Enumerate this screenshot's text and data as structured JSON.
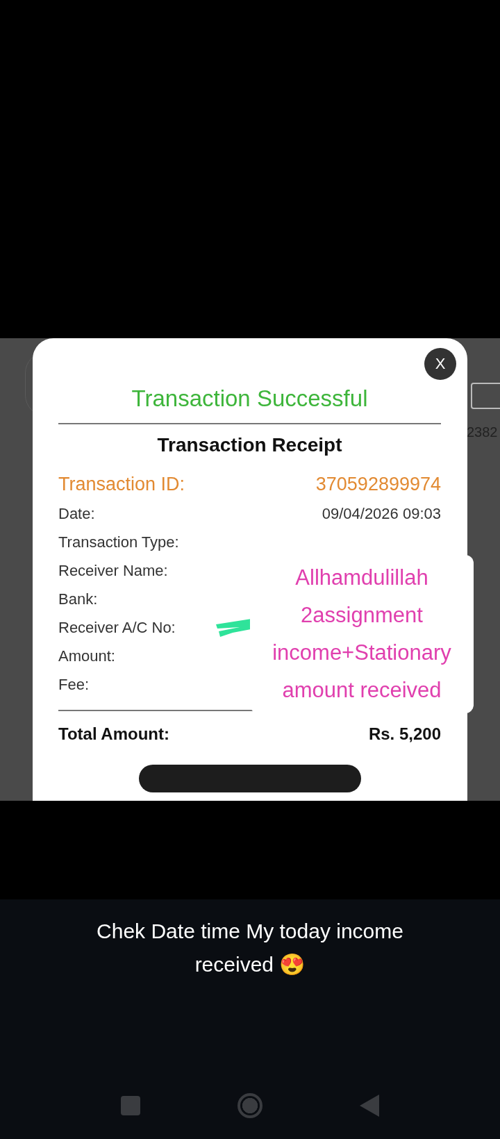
{
  "background": {
    "side_text": "2382"
  },
  "receipt": {
    "status": "Transaction Successful",
    "title": "Transaction Receipt",
    "rows": [
      {
        "kind": "highlight",
        "label": "Transaction ID:",
        "value": "370592899974"
      },
      {
        "kind": "normal",
        "label": "Date:",
        "value": "09/04/2026 09:03"
      },
      {
        "kind": "normal",
        "label": "Transaction Type:"
      },
      {
        "kind": "normal",
        "label": "Receiver Name:"
      },
      {
        "kind": "normal",
        "label": "Bank:"
      },
      {
        "kind": "normal",
        "label": "Receiver A/C No:"
      },
      {
        "kind": "normal",
        "label": "Amount:"
      },
      {
        "kind": "normal",
        "label": "Fee:"
      }
    ],
    "total": {
      "label": "Total Amount:",
      "value": "Rs. 5,200"
    },
    "close": "X"
  },
  "sticker": {
    "lines": [
      "Allhamdulillah",
      "2assignment",
      "income+Stationary",
      "amount received"
    ]
  },
  "caption": "Chek Date time My today income received 😍"
}
